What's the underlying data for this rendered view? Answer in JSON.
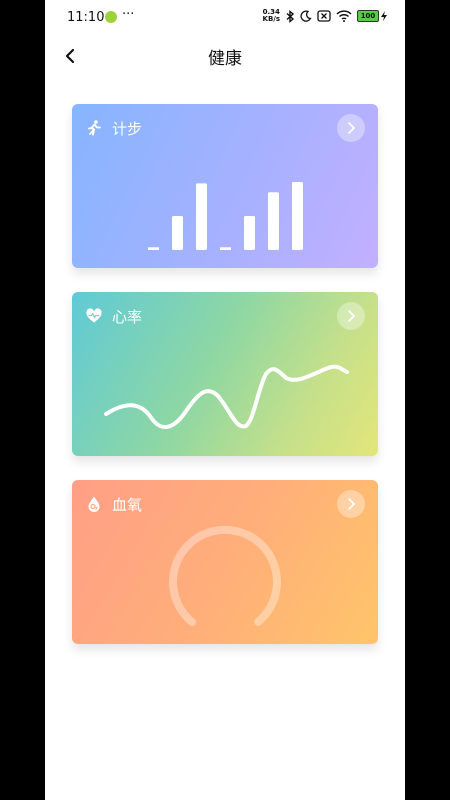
{
  "status_bar": {
    "time": "11:10",
    "dots": "···",
    "net_speed_value": "0.34",
    "net_speed_unit": "KB/s",
    "battery": "100"
  },
  "header": {
    "title": "健康",
    "back_icon": "chevron-left-icon"
  },
  "cards": {
    "steps": {
      "title": "计步",
      "icon": "running-icon",
      "bar_levels": [
        0.04,
        0.5,
        0.98,
        0.04,
        0.5,
        0.85,
        1.0
      ]
    },
    "heart": {
      "title": "心率",
      "icon": "heart-pulse-icon"
    },
    "oxygen": {
      "title": "血氧",
      "icon": "o2-drop-icon"
    }
  },
  "colors": {
    "steps_gradient": [
      "#86b5ff",
      "#c2b0ff"
    ],
    "heart_gradient": [
      "#5fcad6",
      "#e3e67a"
    ],
    "oxygen_gradient": [
      "#ff9f86",
      "#ffc56a"
    ]
  }
}
